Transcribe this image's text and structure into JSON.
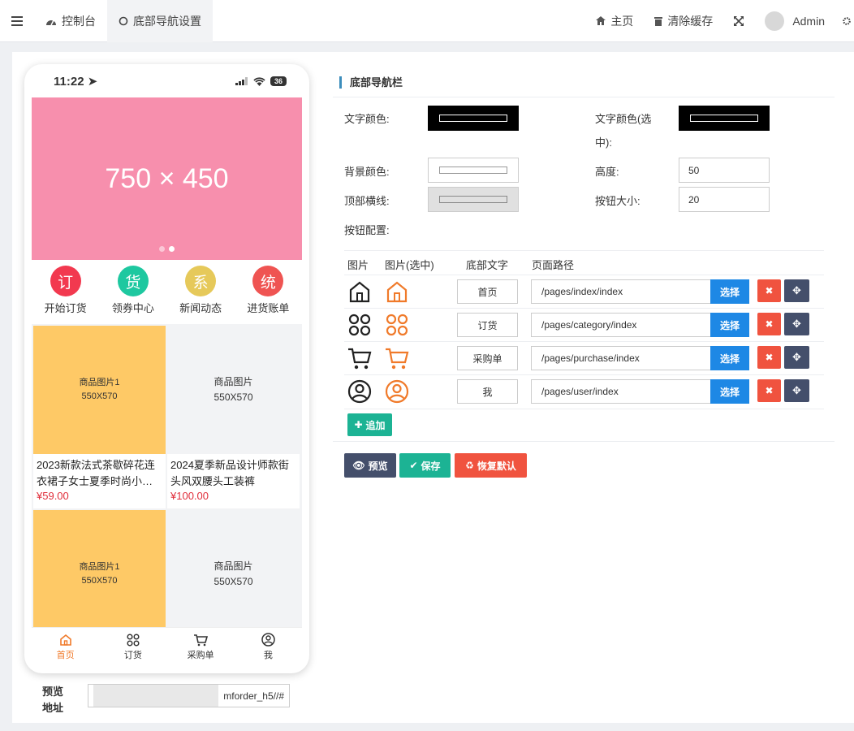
{
  "topbar": {
    "dashboard": "控制台",
    "current_tab": "底部导航设置",
    "home": "主页",
    "clear_cache": "清除缓存",
    "user": "Admin"
  },
  "phone": {
    "time": "11:22",
    "battery": "36",
    "banner_text": "750 × 450",
    "quick_nav": [
      {
        "char": "订",
        "label": "开始订货",
        "color": "#f2394f"
      },
      {
        "char": "货",
        "label": "领券中心",
        "color": "#1ec8a0"
      },
      {
        "char": "系",
        "label": "新闻动态",
        "color": "#e6c95a"
      },
      {
        "char": "统",
        "label": "进货账单",
        "color": "#ef5452"
      }
    ],
    "goods": [
      {
        "img1": "商品图片1",
        "img2": "550X570",
        "title": "2023新款法式茶歇碎花连衣裙子女士夏季时尚小…",
        "price": "¥59.00"
      },
      {
        "img1": "商品图片",
        "img2": "550X570",
        "title": "2024夏季新品设计师款街头风双腰头工装裤",
        "price": "¥100.00"
      },
      {
        "img1": "商品图片1",
        "img2": "550X570"
      },
      {
        "img1": "商品图片",
        "img2": "550X570"
      }
    ],
    "tabbar": [
      "首页",
      "订货",
      "采购单",
      "我"
    ]
  },
  "preview": {
    "label": "预览地址",
    "url": "mforder_h5//#"
  },
  "form": {
    "section_title": "底部导航栏",
    "text_color_label": "文字颜色:",
    "text_color_selected_label_1": "文字颜色(选",
    "text_color_selected_label_2": "中):",
    "bg_color_label": "背景颜色:",
    "height_label": "高度:",
    "height_value": "50",
    "top_line_label": "顶部横线:",
    "button_size_label": "按钮大小:",
    "button_size_value": "20",
    "button_config_label": "按钮配置:",
    "colors": {
      "text": "#000000",
      "text_selected": "#000000",
      "bg": "#ffffff",
      "top_line": "#e0e0e0"
    }
  },
  "table": {
    "headers": [
      "图片",
      "图片(选中)",
      "底部文字",
      "页面路径"
    ],
    "rows": [
      {
        "icon": "home-icon",
        "text": "首页",
        "path": "/pages/index/index"
      },
      {
        "icon": "grid-icon",
        "text": "订货",
        "path": "/pages/category/index"
      },
      {
        "icon": "cart-icon",
        "text": "采购单",
        "path": "/pages/purchase/index"
      },
      {
        "icon": "user-icon",
        "text": "我",
        "path": "/pages/user/index"
      }
    ],
    "select_label": "选择",
    "add_label": "追加"
  },
  "actions": {
    "preview": "预览",
    "save": "保存",
    "reset": "恢复默认"
  }
}
